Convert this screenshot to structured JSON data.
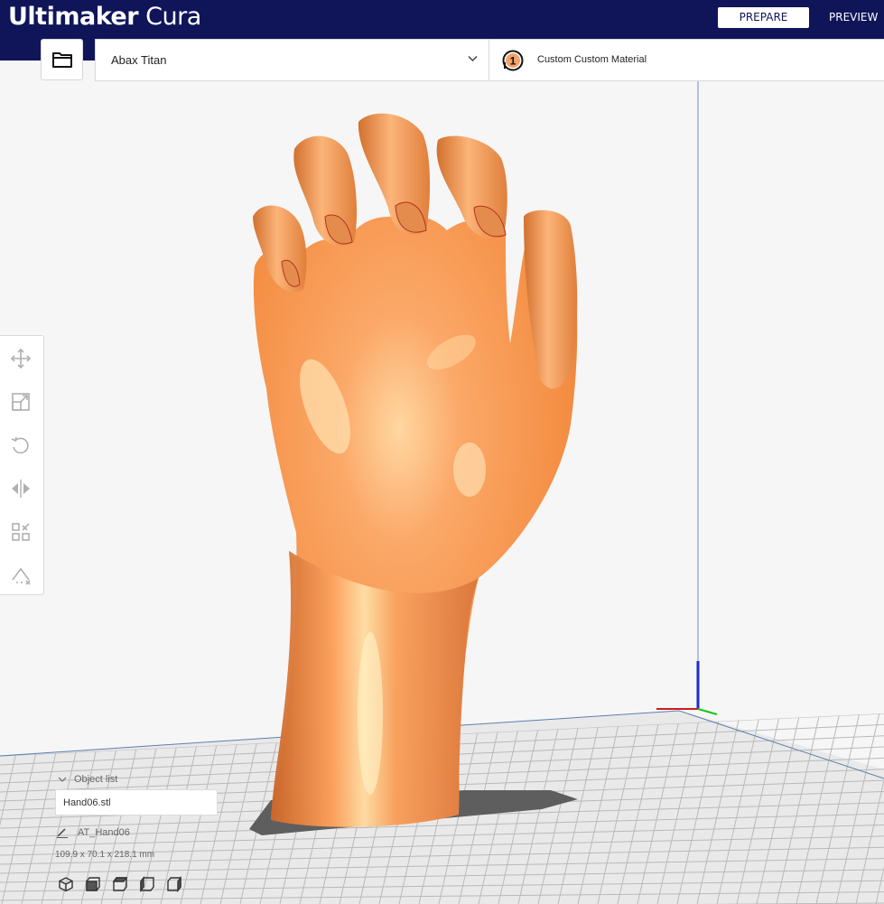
{
  "header": {
    "brand_bold": "Ultimaker",
    "brand_light": "Cura",
    "stage_prepare": "PREPARE",
    "stage_preview": "PREVIEW"
  },
  "machine": {
    "printer_name": "Abax Titan",
    "extruder_number": "1",
    "material_name": "Custom Custom Material"
  },
  "object_list": {
    "header": "Object list",
    "selected_file": "Hand06.stl",
    "object_name": "AT_Hand06",
    "dimensions": "109.9 x 70.1 x 218.1 mm"
  },
  "tools": [
    "move-icon",
    "scale-icon",
    "rotate-icon",
    "mirror-icon",
    "per-model-settings-icon",
    "support-blocker-icon"
  ],
  "view_buttons": [
    "3d-view-icon",
    "front-view-icon",
    "top-view-icon",
    "left-view-icon",
    "right-view-icon"
  ],
  "colors": {
    "header_bg": "#10155a",
    "model": "#f59a51",
    "build_plate": "#e9e9e9",
    "grid_line": "#b9b9b9"
  }
}
